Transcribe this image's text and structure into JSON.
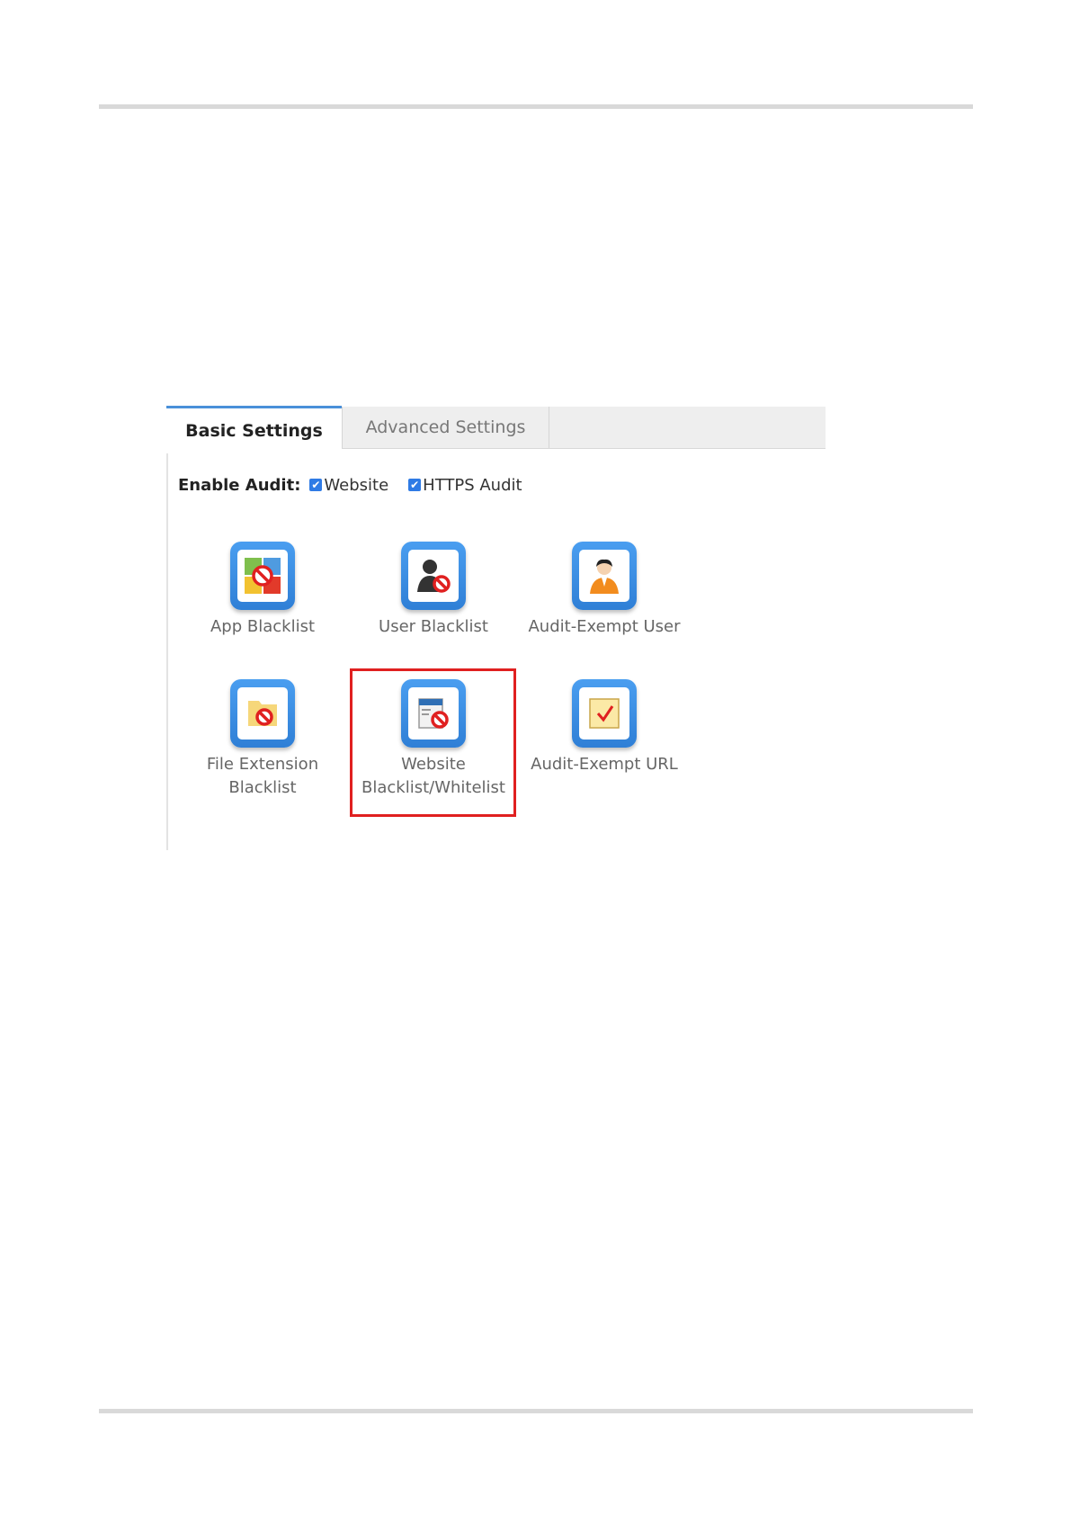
{
  "tabs": {
    "basic": "Basic Settings",
    "advanced": "Advanced Settings"
  },
  "audit": {
    "label": "Enable Audit:",
    "options": [
      {
        "label": "Website",
        "checked": true
      },
      {
        "label": "HTTPS Audit",
        "checked": true
      }
    ]
  },
  "tiles": [
    {
      "label": "App Blacklist",
      "icon": "app-blacklist-icon"
    },
    {
      "label": "User Blacklist",
      "icon": "user-blacklist-icon"
    },
    {
      "label": "Audit-Exempt User",
      "icon": "audit-exempt-user-icon"
    },
    {
      "label": "File Extension Blacklist",
      "icon": "file-extension-blacklist-icon"
    },
    {
      "label": "Website Blacklist/Whitelist",
      "icon": "website-blacklist-icon",
      "highlighted": true
    },
    {
      "label": "Audit-Exempt URL",
      "icon": "audit-exempt-url-icon"
    }
  ],
  "colors": {
    "accent": "#2f7be5",
    "highlight": "#e02020",
    "tile_border": "#3a8ce6"
  }
}
